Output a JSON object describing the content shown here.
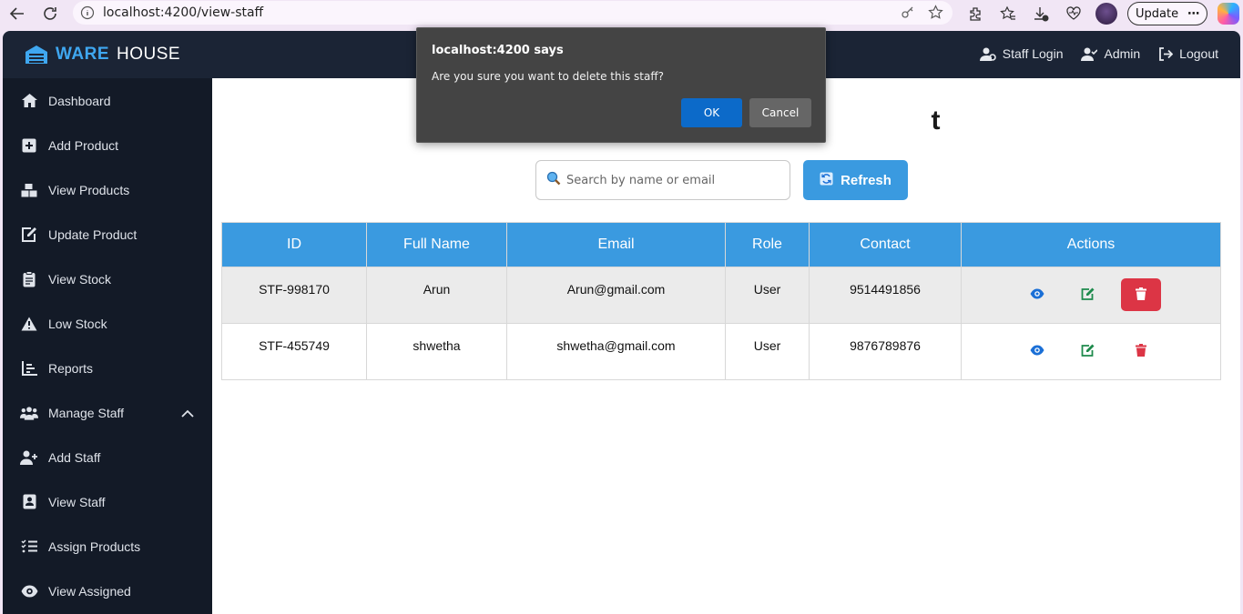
{
  "browser": {
    "url": "localhost:4200/view-staff",
    "update_label": "Update",
    "more_label": "⋯"
  },
  "brand": {
    "part1": "WARE",
    "part2": "HOUSE"
  },
  "topnav": {
    "staff_login": "Staff Login",
    "admin": "Admin",
    "logout": "Logout"
  },
  "sidebar": {
    "items": [
      {
        "label": "Dashboard",
        "icon": "home-icon"
      },
      {
        "label": "Add Product",
        "icon": "plus-square-icon"
      },
      {
        "label": "View Products",
        "icon": "boxes-icon"
      },
      {
        "label": "Update Product",
        "icon": "edit-icon"
      },
      {
        "label": "View Stock",
        "icon": "clipboard-icon"
      },
      {
        "label": "Low Stock",
        "icon": "warning-icon"
      },
      {
        "label": "Reports",
        "icon": "chart-icon"
      },
      {
        "label": "Manage Staff",
        "icon": "users-icon"
      },
      {
        "label": "Add Staff",
        "icon": "user-plus-icon"
      },
      {
        "label": "View Staff",
        "icon": "id-card-icon"
      },
      {
        "label": "Assign Products",
        "icon": "list-check-icon"
      },
      {
        "label": "View Assigned",
        "icon": "eye-icon"
      }
    ]
  },
  "main": {
    "title_visible": "t",
    "search_placeholder": "Search by name or email",
    "refresh_label": "Refresh"
  },
  "table": {
    "headers": [
      "ID",
      "Full Name",
      "Email",
      "Role",
      "Contact",
      "Actions"
    ],
    "rows": [
      {
        "id": "STF-998170",
        "name": "Arun",
        "email": "Arun@gmail.com",
        "role": "User",
        "contact": "9514491856"
      },
      {
        "id": "STF-455749",
        "name": "shwetha",
        "email": "shwetha@gmail.com",
        "role": "User",
        "contact": "9876789876"
      }
    ]
  },
  "dialog": {
    "title": "localhost:4200 says",
    "message": "Are you sure you want to delete this staff?",
    "ok": "OK",
    "cancel": "Cancel"
  },
  "colors": {
    "accent": "#3a9ae0",
    "sidebar_bg": "#131a27",
    "topbar_bg": "#1b2435",
    "danger": "#dc3545",
    "edit_green": "#1e8a4c",
    "view_blue": "#1a6fd6"
  }
}
